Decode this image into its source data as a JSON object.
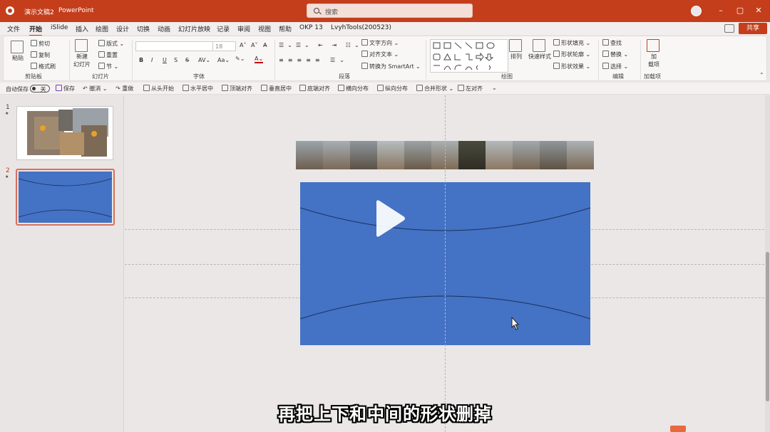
{
  "titlebar": {
    "doc_title": "演示文稿2",
    "app_name": "PowerPoint",
    "search_placeholder": "搜索",
    "min": "–",
    "max": "▢",
    "close": "✕"
  },
  "menu": {
    "tabs": [
      "文件",
      "开始",
      "iSlide",
      "插入",
      "绘图",
      "设计",
      "切换",
      "动画",
      "幻灯片放映",
      "记录",
      "审阅",
      "视图",
      "帮助",
      "OKP 13",
      "LvyhTools(200523)"
    ],
    "active": "开始",
    "share": "共享"
  },
  "ribbon": {
    "clipboard": {
      "paste": "粘贴",
      "cut": "剪切",
      "copy": "复制",
      "format_painter": "格式刷",
      "label": "剪贴板"
    },
    "slides": {
      "new_slide": "新建",
      "new_slide2": "幻灯片",
      "layout": "版式",
      "reset": "重置",
      "section": "节",
      "label": "幻灯片"
    },
    "font": {
      "size": "18",
      "label": "字体",
      "bold": "B",
      "italic": "I",
      "underline": "U",
      "strike": "S",
      "shadow": "S"
    },
    "paragraph": {
      "text_direction": "文字方向",
      "align_text": "对齐文本",
      "smartart": "转换为 SmartArt",
      "label": "段落"
    },
    "drawing": {
      "arrange": "排列",
      "quick_styles": "快速样式",
      "fill": "形状填充",
      "outline": "形状轮廓",
      "effects": "形状效果",
      "label": "绘图"
    },
    "editing": {
      "find": "查找",
      "replace": "替换",
      "select": "选择",
      "label": "编辑"
    },
    "addins": {
      "addin": "加",
      "addin2": "载项",
      "label": "加载项"
    }
  },
  "qat": {
    "autosave": "自动保存",
    "autosave_state": "关",
    "save": "保存",
    "undo": "撤消",
    "redo": "重做",
    "from_start": "从头开始",
    "h_center": "水平居中",
    "top_align": "顶端对齐",
    "v_center": "垂直居中",
    "bottom_align": "底端对齐",
    "h_distribute": "横向分布",
    "v_distribute": "纵向分布",
    "merge_shapes": "合并形状",
    "left_align": "左对齐"
  },
  "thumbnails": [
    {
      "number": "1",
      "star": "★"
    },
    {
      "number": "2",
      "star": "★"
    }
  ],
  "subtitle": "再把上下和中间的形状删掉",
  "colors": {
    "brand": "#c43e1c",
    "slide_blue": "#4472c4"
  }
}
